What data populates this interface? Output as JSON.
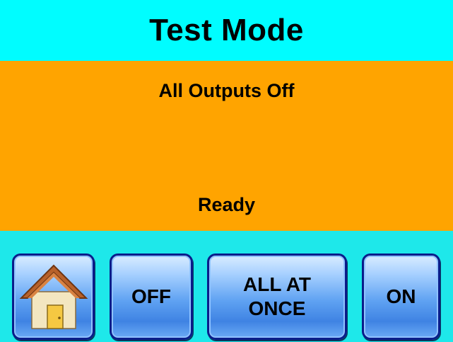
{
  "title": "Test Mode",
  "status": {
    "message": "All Outputs Off",
    "state": "Ready"
  },
  "buttons": {
    "home_icon": "home-icon",
    "off_label": "OFF",
    "all_at_once_label_line1": "ALL AT",
    "all_at_once_label_line2": "ONCE",
    "on_label": "ON"
  },
  "colors": {
    "title_bg": "#00fdff",
    "status_bg": "#ffa400",
    "footer_bg": "#1ee8ea",
    "button_border": "#0a1d8a"
  }
}
